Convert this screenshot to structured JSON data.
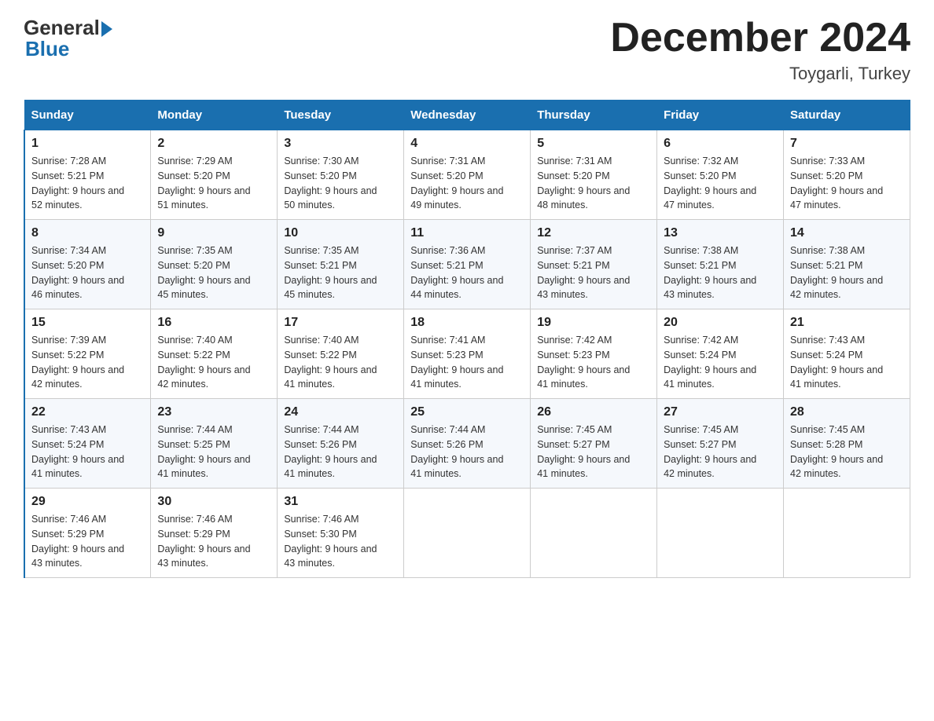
{
  "logo": {
    "general": "General",
    "blue": "Blue"
  },
  "title": "December 2024",
  "location": "Toygarli, Turkey",
  "headers": [
    "Sunday",
    "Monday",
    "Tuesday",
    "Wednesday",
    "Thursday",
    "Friday",
    "Saturday"
  ],
  "weeks": [
    [
      {
        "day": "1",
        "sunrise": "7:28 AM",
        "sunset": "5:21 PM",
        "daylight": "9 hours and 52 minutes."
      },
      {
        "day": "2",
        "sunrise": "7:29 AM",
        "sunset": "5:20 PM",
        "daylight": "9 hours and 51 minutes."
      },
      {
        "day": "3",
        "sunrise": "7:30 AM",
        "sunset": "5:20 PM",
        "daylight": "9 hours and 50 minutes."
      },
      {
        "day": "4",
        "sunrise": "7:31 AM",
        "sunset": "5:20 PM",
        "daylight": "9 hours and 49 minutes."
      },
      {
        "day": "5",
        "sunrise": "7:31 AM",
        "sunset": "5:20 PM",
        "daylight": "9 hours and 48 minutes."
      },
      {
        "day": "6",
        "sunrise": "7:32 AM",
        "sunset": "5:20 PM",
        "daylight": "9 hours and 47 minutes."
      },
      {
        "day": "7",
        "sunrise": "7:33 AM",
        "sunset": "5:20 PM",
        "daylight": "9 hours and 47 minutes."
      }
    ],
    [
      {
        "day": "8",
        "sunrise": "7:34 AM",
        "sunset": "5:20 PM",
        "daylight": "9 hours and 46 minutes."
      },
      {
        "day": "9",
        "sunrise": "7:35 AM",
        "sunset": "5:20 PM",
        "daylight": "9 hours and 45 minutes."
      },
      {
        "day": "10",
        "sunrise": "7:35 AM",
        "sunset": "5:21 PM",
        "daylight": "9 hours and 45 minutes."
      },
      {
        "day": "11",
        "sunrise": "7:36 AM",
        "sunset": "5:21 PM",
        "daylight": "9 hours and 44 minutes."
      },
      {
        "day": "12",
        "sunrise": "7:37 AM",
        "sunset": "5:21 PM",
        "daylight": "9 hours and 43 minutes."
      },
      {
        "day": "13",
        "sunrise": "7:38 AM",
        "sunset": "5:21 PM",
        "daylight": "9 hours and 43 minutes."
      },
      {
        "day": "14",
        "sunrise": "7:38 AM",
        "sunset": "5:21 PM",
        "daylight": "9 hours and 42 minutes."
      }
    ],
    [
      {
        "day": "15",
        "sunrise": "7:39 AM",
        "sunset": "5:22 PM",
        "daylight": "9 hours and 42 minutes."
      },
      {
        "day": "16",
        "sunrise": "7:40 AM",
        "sunset": "5:22 PM",
        "daylight": "9 hours and 42 minutes."
      },
      {
        "day": "17",
        "sunrise": "7:40 AM",
        "sunset": "5:22 PM",
        "daylight": "9 hours and 41 minutes."
      },
      {
        "day": "18",
        "sunrise": "7:41 AM",
        "sunset": "5:23 PM",
        "daylight": "9 hours and 41 minutes."
      },
      {
        "day": "19",
        "sunrise": "7:42 AM",
        "sunset": "5:23 PM",
        "daylight": "9 hours and 41 minutes."
      },
      {
        "day": "20",
        "sunrise": "7:42 AM",
        "sunset": "5:24 PM",
        "daylight": "9 hours and 41 minutes."
      },
      {
        "day": "21",
        "sunrise": "7:43 AM",
        "sunset": "5:24 PM",
        "daylight": "9 hours and 41 minutes."
      }
    ],
    [
      {
        "day": "22",
        "sunrise": "7:43 AM",
        "sunset": "5:24 PM",
        "daylight": "9 hours and 41 minutes."
      },
      {
        "day": "23",
        "sunrise": "7:44 AM",
        "sunset": "5:25 PM",
        "daylight": "9 hours and 41 minutes."
      },
      {
        "day": "24",
        "sunrise": "7:44 AM",
        "sunset": "5:26 PM",
        "daylight": "9 hours and 41 minutes."
      },
      {
        "day": "25",
        "sunrise": "7:44 AM",
        "sunset": "5:26 PM",
        "daylight": "9 hours and 41 minutes."
      },
      {
        "day": "26",
        "sunrise": "7:45 AM",
        "sunset": "5:27 PM",
        "daylight": "9 hours and 41 minutes."
      },
      {
        "day": "27",
        "sunrise": "7:45 AM",
        "sunset": "5:27 PM",
        "daylight": "9 hours and 42 minutes."
      },
      {
        "day": "28",
        "sunrise": "7:45 AM",
        "sunset": "5:28 PM",
        "daylight": "9 hours and 42 minutes."
      }
    ],
    [
      {
        "day": "29",
        "sunrise": "7:46 AM",
        "sunset": "5:29 PM",
        "daylight": "9 hours and 43 minutes."
      },
      {
        "day": "30",
        "sunrise": "7:46 AM",
        "sunset": "5:29 PM",
        "daylight": "9 hours and 43 minutes."
      },
      {
        "day": "31",
        "sunrise": "7:46 AM",
        "sunset": "5:30 PM",
        "daylight": "9 hours and 43 minutes."
      },
      null,
      null,
      null,
      null
    ]
  ],
  "labels": {
    "sunrise": "Sunrise: ",
    "sunset": "Sunset: ",
    "daylight": "Daylight: "
  }
}
